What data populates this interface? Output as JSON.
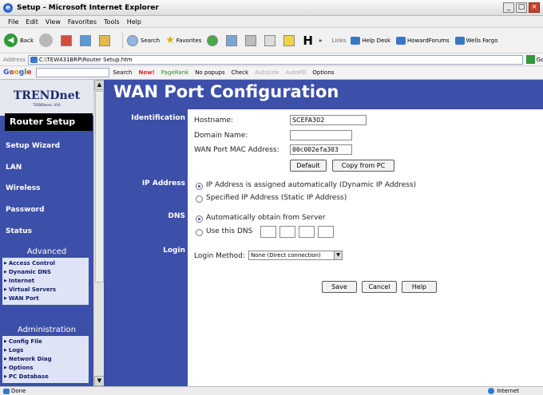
{
  "window": {
    "title": "Setup - Microsoft Internet Explorer",
    "buttons": [
      "_",
      "□",
      "×"
    ]
  },
  "menu": [
    "File",
    "Edit",
    "View",
    "Favorites",
    "Tools",
    "Help"
  ],
  "toolbar": {
    "back": "Back",
    "search": "Search",
    "favorites": "Favorites",
    "more": "»",
    "links_label": "Links",
    "links": [
      "Help Desk",
      "HowardForums",
      "Wells Fargo"
    ]
  },
  "address": {
    "label": "Address",
    "value": "C:\\TEW431BRP\\Router Setup.htm",
    "go": "Go"
  },
  "google_bar": {
    "search": "Search",
    "new": "New!",
    "pagerank": "PageRank",
    "popups": "No popups",
    "check": "Check",
    "autolink": "AutoLink",
    "autofill": "AutoFill",
    "options": "Options"
  },
  "nav": {
    "logo_brand": "TRENDnet",
    "logo_sub": "TRENDware, USA",
    "router_setup": "Router Setup",
    "links": [
      "Setup Wizard",
      "LAN",
      "Wireless",
      "Password",
      "Status"
    ],
    "advanced_label": "Advanced",
    "advanced_items": [
      "Access Control",
      "Dynamic DNS",
      "Internet",
      "Virtual Servers",
      "WAN Port"
    ],
    "administration_label": "Administration",
    "admin_items": [
      "Config File",
      "Logs",
      "Network Diag",
      "Options",
      "PC Database"
    ]
  },
  "main": {
    "title": "WAN Port Configuration",
    "identification": {
      "label": "Identification",
      "hostname_label": "Hostname:",
      "hostname_value": "SCEFA302",
      "domain_label": "Domain Name:",
      "domain_value": "",
      "mac_label": "WAN Port MAC Address:",
      "mac_value": "00c002efa303",
      "default_button": "Default",
      "copy_button": "Copy from PC"
    },
    "ip_address": {
      "label": "IP Address",
      "option_dynamic": "IP Address is assigned automatically (Dynamic IP Address)",
      "option_static": "Specified IP Address (Static IP Address)",
      "selected": "dynamic"
    },
    "dns": {
      "label": "DNS",
      "option_auto": "Automatically obtain from Server",
      "option_manual": "Use this DNS",
      "selected": "auto"
    },
    "login": {
      "label": "Login",
      "method_label": "Login Method:",
      "method_value": "None (Direct connection)"
    },
    "buttons": {
      "save": "Save",
      "cancel": "Cancel",
      "help": "Help"
    }
  },
  "status": {
    "left": "Done",
    "zone": "Internet"
  }
}
